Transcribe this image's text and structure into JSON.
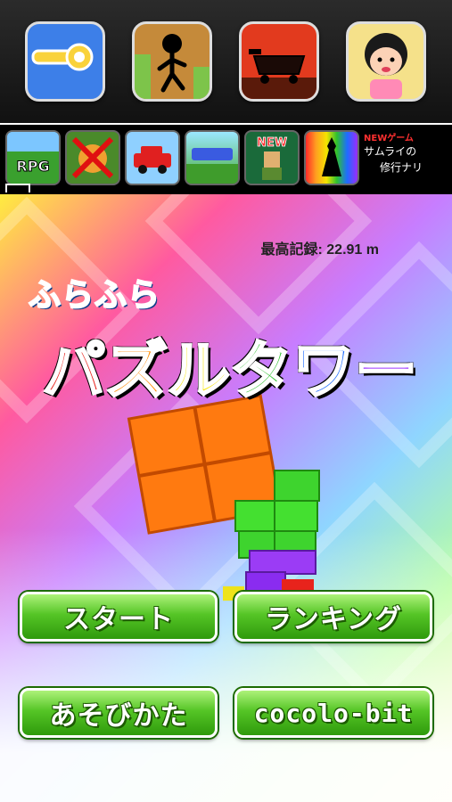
{
  "promo": {
    "big_icons": [
      {
        "name": "pin-app-icon",
        "bg": "#3d7fe8"
      },
      {
        "name": "stickman-app-icon",
        "bg": "#c58a3a"
      },
      {
        "name": "cart-app-icon",
        "bg": "#e23a1e"
      },
      {
        "name": "auntie-app-icon",
        "bg": "#f5e18a"
      }
    ],
    "small_icons": [
      {
        "name": "rpg-app-icon",
        "label": "RPG"
      },
      {
        "name": "crossed-app-icon",
        "label": ""
      },
      {
        "name": "car-app-icon",
        "label": ""
      },
      {
        "name": "quest-app-icon",
        "label": ""
      },
      {
        "name": "new-game-app-icon",
        "label": "NEW"
      },
      {
        "name": "silhouette-app-icon",
        "label": ""
      }
    ],
    "ad": {
      "new_label": "NEWゲーム",
      "line1": "サムライの",
      "line2": "修行ナリ"
    }
  },
  "game": {
    "record_label": "最高記録: 22.91 m",
    "subtitle": "ふらふら",
    "title_chars": [
      {
        "char": "パ",
        "color": "#e8231c"
      },
      {
        "char": "ズ",
        "color": "#ff8a00"
      },
      {
        "char": "ル",
        "color": "#f5e400"
      },
      {
        "char": "タ",
        "color": "#2ec12e"
      },
      {
        "char": "ワ",
        "color": "#1e6cff"
      },
      {
        "char": "ー",
        "color": "#9b2cff"
      }
    ],
    "buttons": {
      "start": "スタート",
      "ranking": "ランキング",
      "howto": "あそびかた",
      "cocolo": "cocolo-bit"
    }
  }
}
